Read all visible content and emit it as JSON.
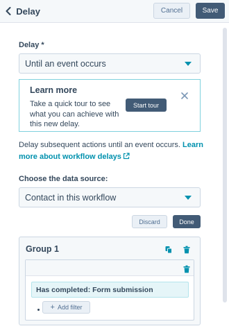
{
  "header": {
    "title": "Delay",
    "cancel_label": "Cancel",
    "save_label": "Save"
  },
  "delay": {
    "label": "Delay *",
    "selected": "Until an event occurs"
  },
  "tour": {
    "title": "Learn more",
    "text": "Take a quick tour to see what you can achieve with this new delay.",
    "button_label": "Start tour"
  },
  "description": {
    "text": "Delay subsequent actions until an event occurs. ",
    "link": "Learn more about workflow delays"
  },
  "data_source": {
    "label": "Choose the data source:",
    "selected": "Contact in this workflow"
  },
  "actions": {
    "discard_label": "Discard",
    "done_label": "Done"
  },
  "group": {
    "title": "Group 1",
    "filter": "Has completed: Form submission",
    "add_filter_label": "Add filter"
  },
  "colors": {
    "accent": "#0091ae",
    "primary_button": "#425b76",
    "text": "#33475b"
  },
  "icons": [
    "back-chevron-icon",
    "caret-down-icon",
    "close-icon",
    "external-link-icon",
    "clone-icon",
    "trash-icon",
    "plus-icon"
  ]
}
